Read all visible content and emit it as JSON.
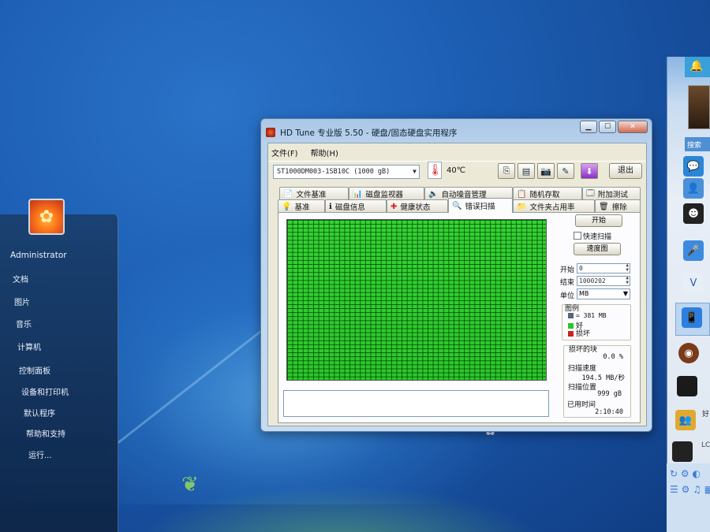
{
  "window": {
    "title": "HD Tune 专业版 5.50 - 硬盘/固态硬盘实用程序",
    "controls": [
      "▁",
      "☐",
      "✕"
    ]
  },
  "menu": [
    "文件(F)",
    "帮助(H)"
  ],
  "toolbar": {
    "drive": "ST1000DM003-1SB10C (1000 gB)",
    "temperature": "40℃",
    "exit": "退出"
  },
  "tabs_row1": [
    {
      "label": "文件基准",
      "icon": "📄"
    },
    {
      "label": "磁盘监视器",
      "icon": "📊"
    },
    {
      "label": "自动噪音管理",
      "icon": "🔈"
    },
    {
      "label": "随机存取",
      "icon": "📋"
    },
    {
      "label": "附加测试",
      "icon": "🗔"
    }
  ],
  "tabs_row2": [
    {
      "label": "基准",
      "icon": "💡"
    },
    {
      "label": "磁盘信息",
      "icon": "ℹ"
    },
    {
      "label": "健康状态",
      "icon": "✚"
    },
    {
      "label": "错误扫描",
      "icon": "🔍"
    },
    {
      "label": "文件夹占用率",
      "icon": "📁"
    },
    {
      "label": "擦除",
      "icon": "🗑"
    }
  ],
  "scan_panel": {
    "start_button": "开始",
    "quick_scan": "快速扫描",
    "speed_map_button": "速度图",
    "start_label": "开始",
    "start_value": "0",
    "end_label": "结束",
    "end_value": "1000202",
    "unit_label": "单位",
    "unit_value": "MB",
    "legend_label": "图例",
    "legend_block": "= 381 MB",
    "legend_good": "好",
    "legend_bad": "损坏",
    "damaged_blocks_label": "损坏的块",
    "damaged_blocks_value": "0.0 %",
    "scan_speed_label": "扫描速度",
    "scan_speed_value": "194.5 MB/秒",
    "scan_position_label": "扫描位置",
    "scan_position_value": "999 gB",
    "elapsed_label": "已用时间",
    "elapsed_value": "2:10:40"
  },
  "colors": {
    "good": "#2cc72c",
    "bad": "#cc2222",
    "block": "#556677"
  },
  "start_menu": {
    "user": "Administrator",
    "items": [
      "文档",
      "图片",
      "音乐",
      "计算机",
      "控制面板",
      "设备和打印机",
      "默认程序",
      "帮助和支持",
      "运行..."
    ]
  },
  "qq_panel": {
    "search_label": "搜索",
    "name_fragment": "好",
    "lc_fragment": "LC"
  }
}
